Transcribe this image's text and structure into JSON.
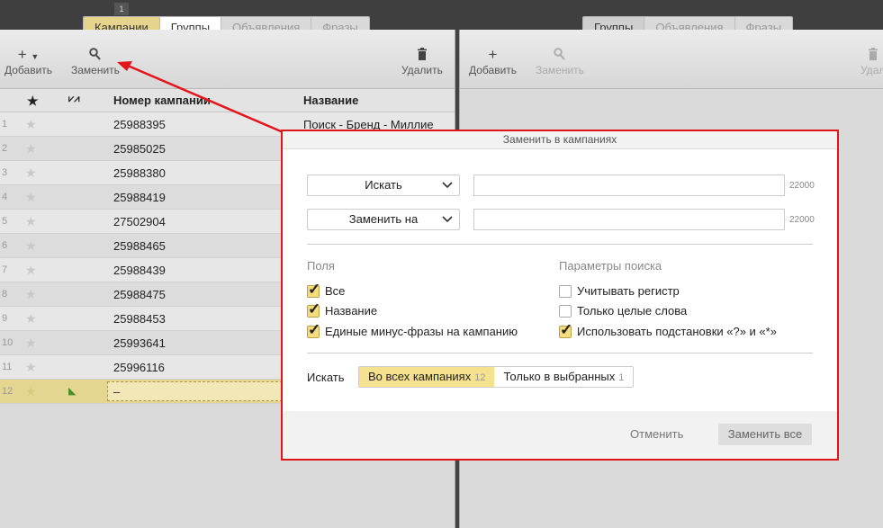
{
  "top_number": "1",
  "left_tabs": [
    "Кампании",
    "Группы",
    "Объявления",
    "Фразы"
  ],
  "right_tabs": [
    "Группы",
    "Объявления",
    "Фразы"
  ],
  "left_toolbar": {
    "add": "Добавить",
    "replace": "Заменить",
    "delete": "Удалить"
  },
  "right_toolbar": {
    "add": "Добавить",
    "replace": "Заменить",
    "delete": "Удал"
  },
  "table": {
    "headers": {
      "num": "Номер кампании",
      "name": "Название"
    },
    "rows": [
      {
        "n": "1",
        "id": "25988395",
        "name": "Поиск - Бренд - Миллие"
      },
      {
        "n": "2",
        "id": "25985025",
        "name": ""
      },
      {
        "n": "3",
        "id": "25988380",
        "name": ""
      },
      {
        "n": "4",
        "id": "25988419",
        "name": ""
      },
      {
        "n": "5",
        "id": "27502904",
        "name": ""
      },
      {
        "n": "6",
        "id": "25988465",
        "name": ""
      },
      {
        "n": "7",
        "id": "25988439",
        "name": ""
      },
      {
        "n": "8",
        "id": "25988475",
        "name": ""
      },
      {
        "n": "9",
        "id": "25988453",
        "name": ""
      },
      {
        "n": "10",
        "id": "25993641",
        "name": ""
      },
      {
        "n": "11",
        "id": "25996116",
        "name": ""
      }
    ],
    "new_row": {
      "n": "12",
      "value": "–"
    }
  },
  "dialog": {
    "title": "Заменить в кампаниях",
    "search_select": "Искать",
    "replace_select": "Заменить на",
    "limit": "22000",
    "fields_title": "Поля",
    "fields": [
      {
        "label": "Все",
        "checked": true
      },
      {
        "label": "Название",
        "checked": true
      },
      {
        "label": "Единые минус-фразы на кампанию",
        "checked": true
      }
    ],
    "params_title": "Параметры поиска",
    "params": [
      {
        "label": "Учитывать регистр",
        "checked": false
      },
      {
        "label": "Только целые слова",
        "checked": false
      },
      {
        "label": "Использовать подстановки «?» и «*»",
        "checked": true
      }
    ],
    "scope_label": "Искать",
    "scope_all": "Во всех кампаниях",
    "scope_all_count": "12",
    "scope_selected": "Только в выбранных",
    "scope_selected_count": "1",
    "cancel": "Отменить",
    "replace_all": "Заменить все"
  },
  "colors": {
    "accent": "#e6d48c",
    "highlight_border": "#e3151a"
  }
}
